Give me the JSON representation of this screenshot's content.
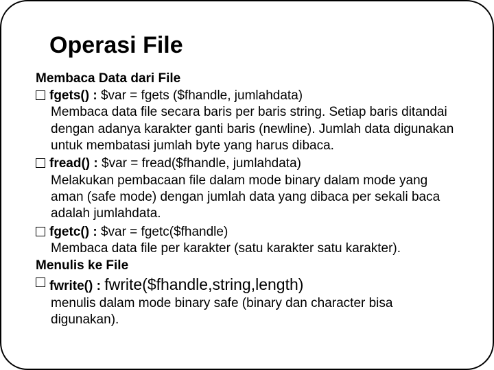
{
  "title": "Operasi File",
  "section1": "Membaca Data dari File",
  "items": [
    {
      "name": "fgets() : ",
      "sig": "$var = fgets ($fhandle, jumlahdata)",
      "desc": "Membaca data file secara baris per baris string. Setiap baris ditandai dengan adanya karakter ganti baris (newline). Jumlah data digunakan untuk membatasi jumlah byte yang harus dibaca."
    },
    {
      "name": "fread() : ",
      "sig": "$var = fread($fhandle, jumlahdata)",
      "desc": "Melakukan pembacaan file dalam mode binary dalam mode yang aman (safe mode) dengan jumlah data yang dibaca per sekali baca adalah jumlahdata."
    },
    {
      "name": "fgetc() : ",
      "sig": "$var = fgetc($fhandle)",
      "desc": "Membaca data file per karakter (satu karakter satu karakter)."
    }
  ],
  "section2": "Menulis ke File",
  "fwrite": {
    "name": "fwrite() : ",
    "sig": "fwrite($fhandle,string,length)",
    "desc": "menulis dalam mode binary safe (binary dan character bisa digunakan)."
  }
}
